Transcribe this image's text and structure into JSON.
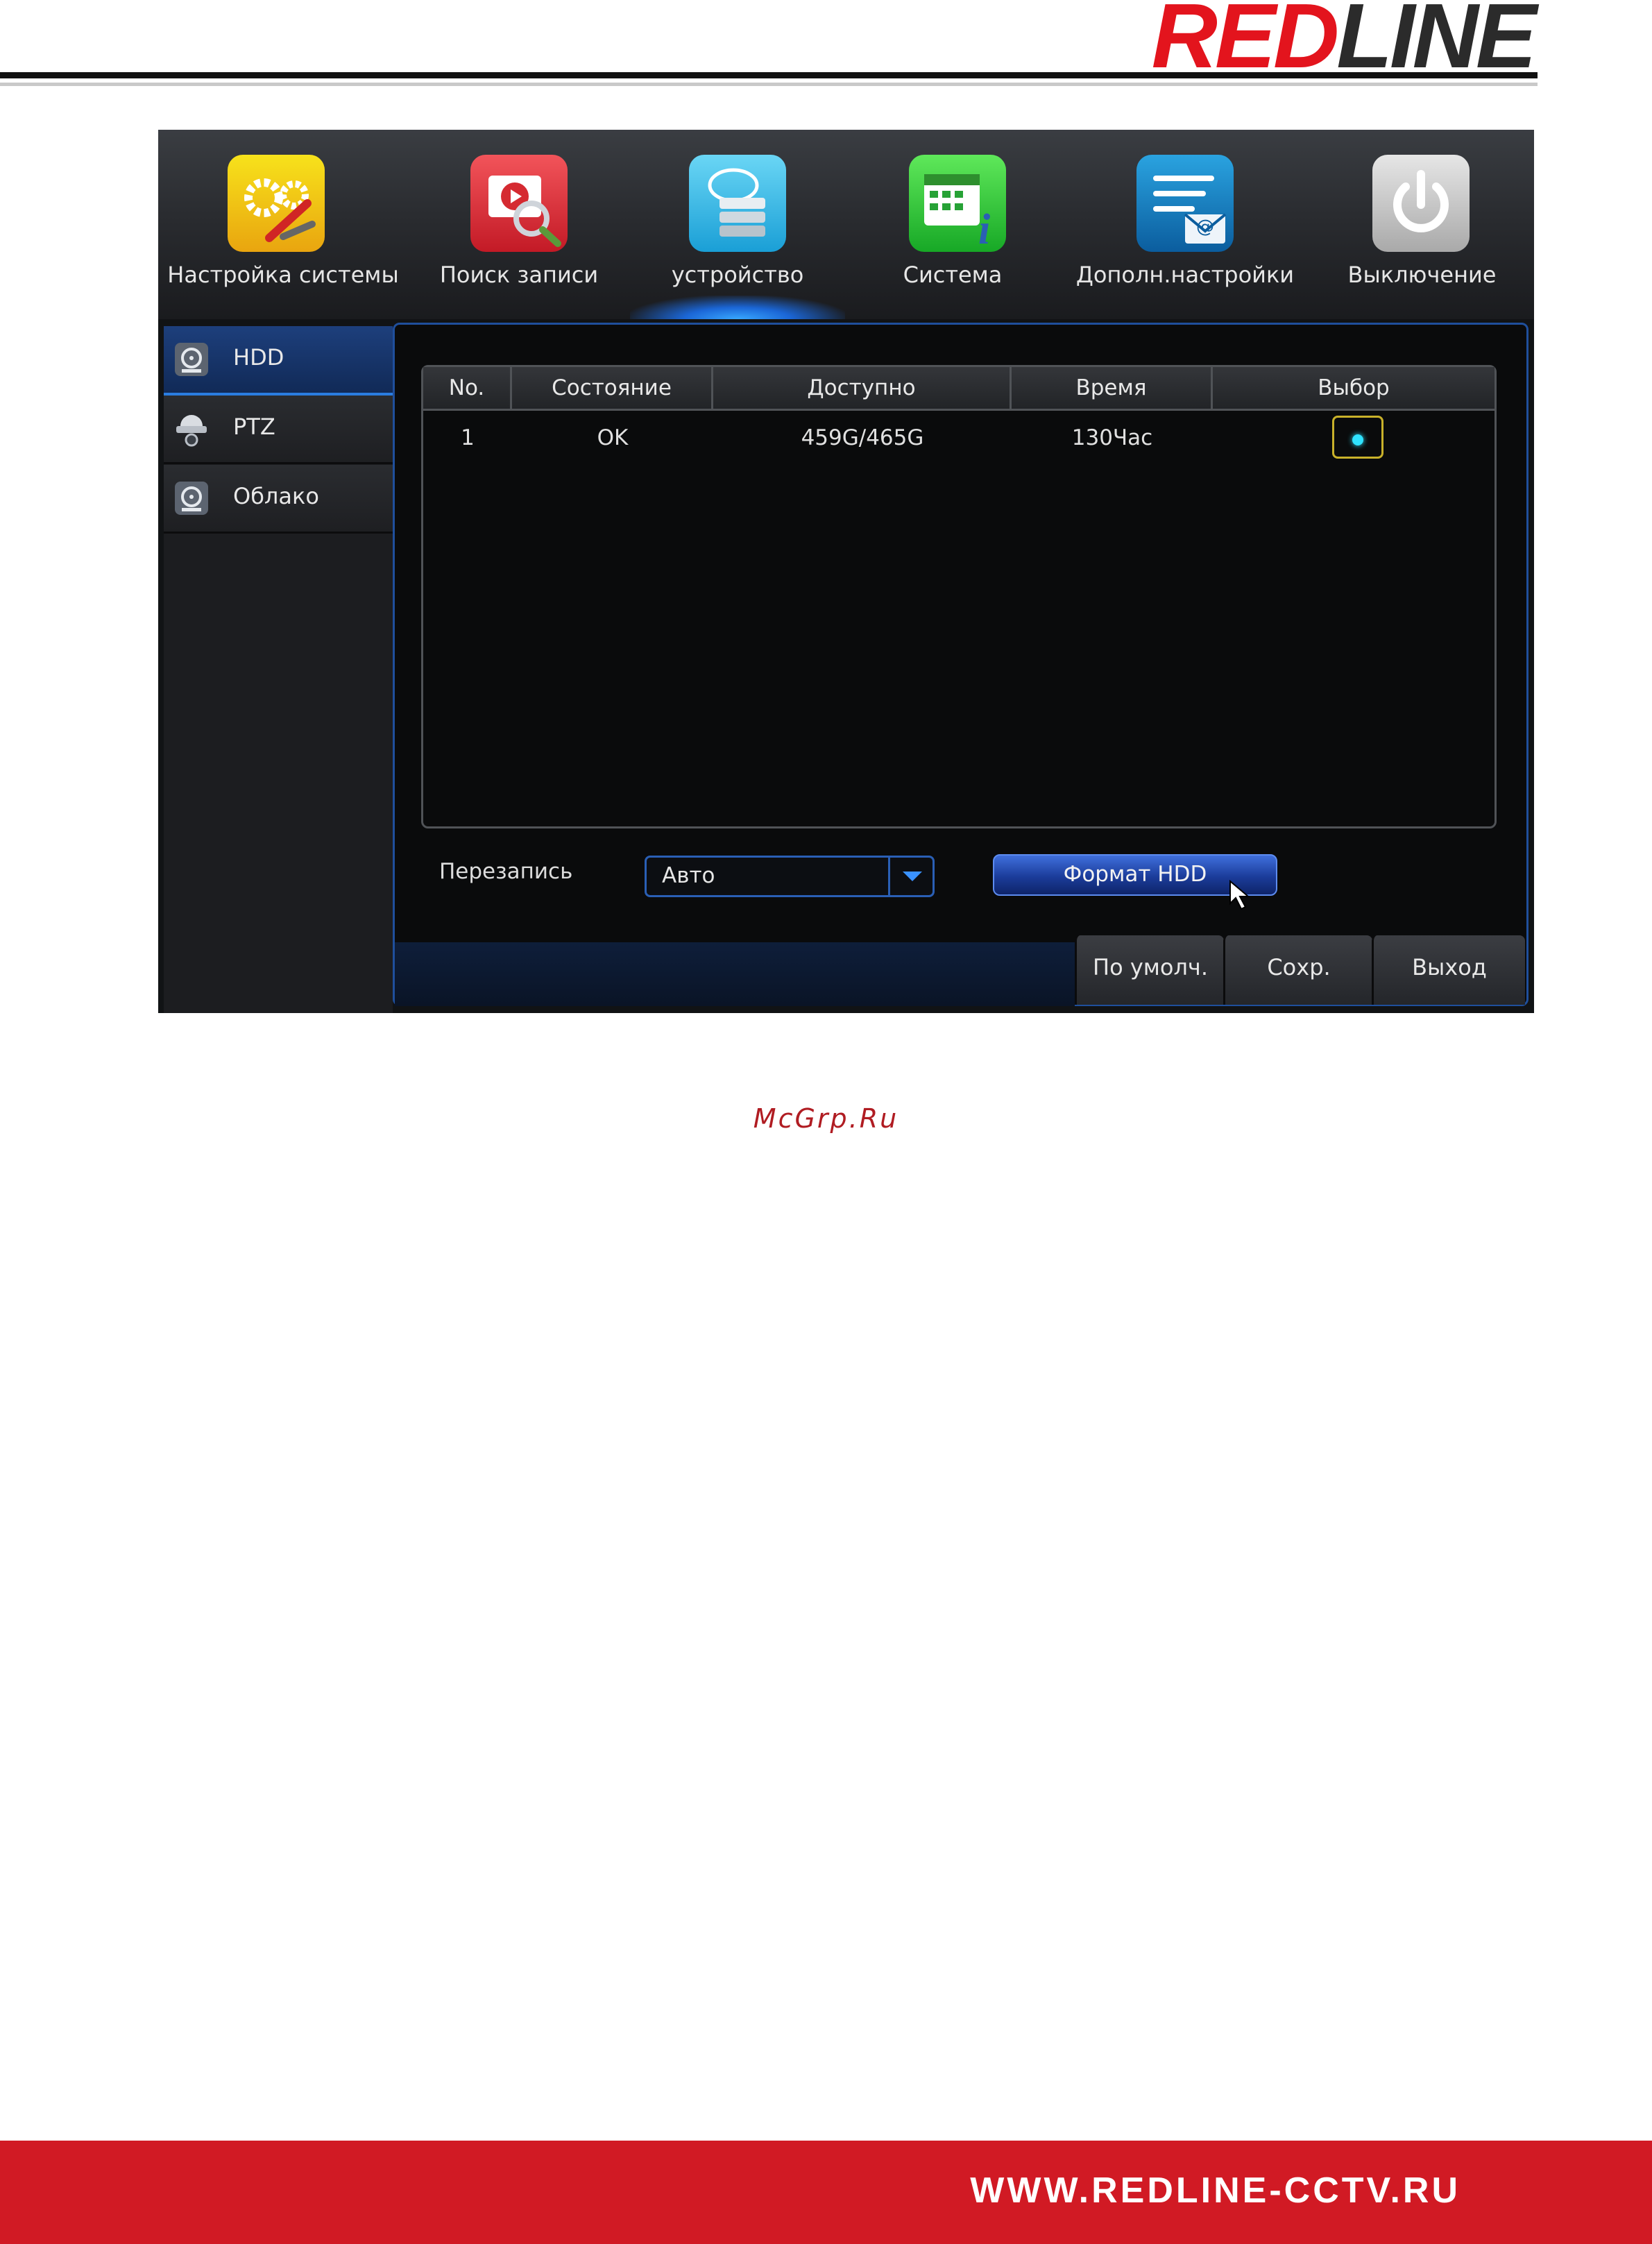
{
  "brand": {
    "logo_red": "RED",
    "logo_dark": "LINE"
  },
  "top_menu": [
    {
      "label": "Настройка системы",
      "icon": "gears-icon"
    },
    {
      "label": "Поиск записи",
      "icon": "video-search-icon"
    },
    {
      "label": "устройство",
      "icon": "storage-device-icon",
      "active": true
    },
    {
      "label": "Система",
      "icon": "calendar-info-icon"
    },
    {
      "label": "Дополн.настройки",
      "icon": "list-mail-icon"
    },
    {
      "label": "Выключение",
      "icon": "power-icon"
    }
  ],
  "side_menu": [
    {
      "label": "HDD",
      "icon": "hdd-icon",
      "active": true
    },
    {
      "label": "PTZ",
      "icon": "ptz-camera-icon"
    },
    {
      "label": "Облако",
      "icon": "cloud-drive-icon"
    }
  ],
  "table": {
    "headers": [
      "No.",
      "Состояние",
      "Доступно",
      "Время",
      "Выбор"
    ],
    "rows": [
      {
        "no": "1",
        "state": "OK",
        "available": "459G/465G",
        "time": "130Час",
        "selected": true
      }
    ]
  },
  "overwrite": {
    "label": "Перезапись",
    "value": "Авто"
  },
  "format_button": "Формат HDD",
  "bottom_buttons": {
    "default": "По умолч.",
    "save": "Сохр.",
    "exit": "Выход"
  },
  "watermark": "McGrp.Ru",
  "footer_url": "WWW.REDLINE-CCTV.RU",
  "colors": {
    "brand_red": "#e3141d",
    "accent_blue": "#2a7de0",
    "select_dot": "#2fe3ff"
  }
}
